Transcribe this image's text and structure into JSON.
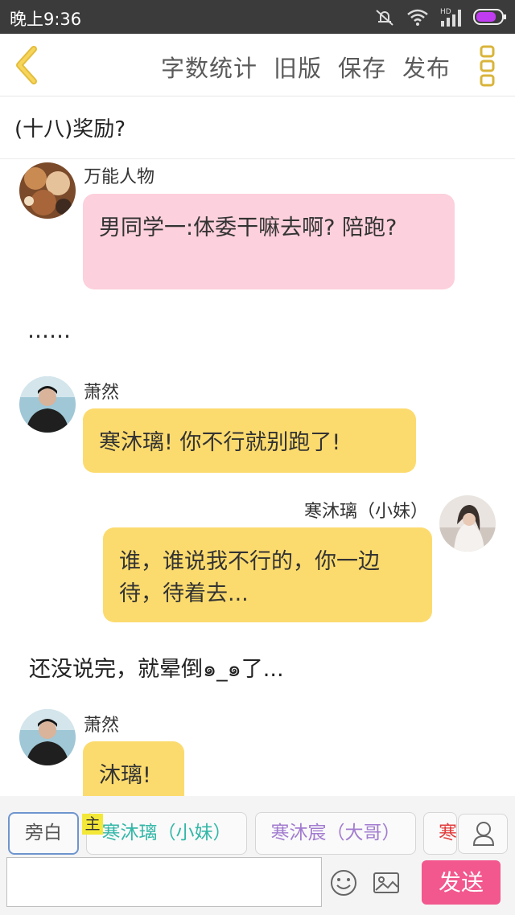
{
  "status_bar": {
    "time": "晚上9:36",
    "icons": [
      "mute-icon",
      "wifi-icon",
      "hd-signal-icon",
      "battery-icon"
    ],
    "hd_label": "HD"
  },
  "toolbar": {
    "back_icon": "chevron-left-icon",
    "actions": [
      "字数统计",
      "旧版",
      "保存",
      "发布"
    ],
    "more_icon": "more-vertical-icon",
    "accent_color": "#f0c94a"
  },
  "chapter": {
    "title": "(十八)奖励?"
  },
  "messages": [
    {
      "type": "left",
      "speaker": "万能人物",
      "text": "男同学一:体委干嘛去啊? 陪跑?",
      "color": "#fcd0dc"
    },
    {
      "type": "narration",
      "text": "……"
    },
    {
      "type": "left",
      "speaker": "萧然",
      "text": "寒沐璃! 你不行就别跑了!",
      "color": "#fcdb6e"
    },
    {
      "type": "right",
      "speaker": "寒沐璃（小妹）",
      "text": "谁，谁说我不行的，你一边待，待着去...",
      "color": "#fcdb6e"
    },
    {
      "type": "narration",
      "text": "还没说完，就晕倒๑_๑了..."
    },
    {
      "type": "left",
      "speaker": "萧然",
      "text": "沐璃!",
      "color": "#fcdb6e"
    }
  ],
  "roles": {
    "items": [
      "旁白",
      "寒沐璃（小妹）",
      "寒沐宸（大哥）",
      "寒"
    ],
    "main_tag": "主",
    "selected": "旁白"
  },
  "composer": {
    "input_value": "",
    "send_label": "发送",
    "send_color": "#f2578d"
  }
}
